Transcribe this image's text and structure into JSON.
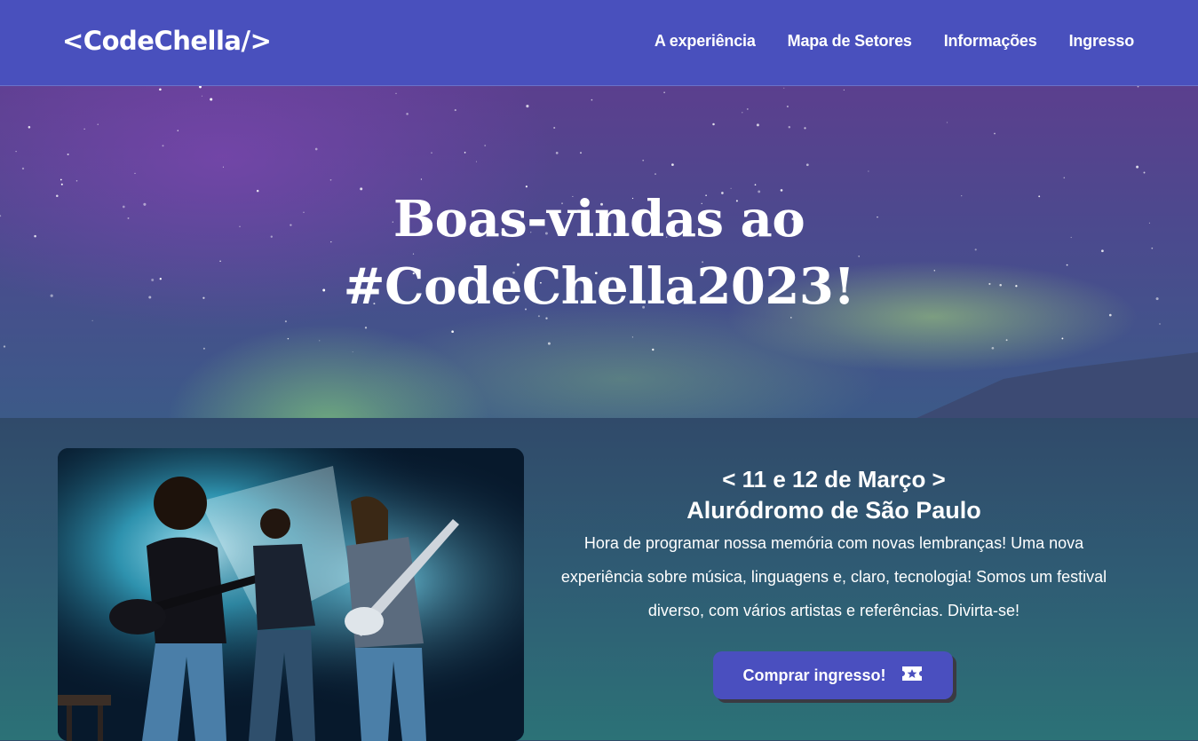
{
  "header": {
    "logo": "<CodeChella/>",
    "nav": [
      "A experiência",
      "Mapa de Setores",
      "Informações",
      "Ingresso"
    ]
  },
  "hero": {
    "title_line1": "Boas-vindas ao",
    "title_line2": "#CodeChella2023!"
  },
  "event": {
    "date": "< 11 e 12 de Março >",
    "venue": "Aluródromo de São Paulo",
    "description": "Hora de programar nossa memória com novas lembranças! Uma nova experiência sobre música, linguagens e, claro, tecnologia! Somos um festival diverso, com vários artistas e referências. Divirta-se!",
    "buy_label": "Comprar ingresso!",
    "buy_icon": "ticket-icon"
  },
  "colors": {
    "header_bg": "#4950bd",
    "button_bg": "#4a4fbf",
    "main_gradient_top": "#304a6a",
    "main_gradient_bottom": "#2c7277"
  }
}
